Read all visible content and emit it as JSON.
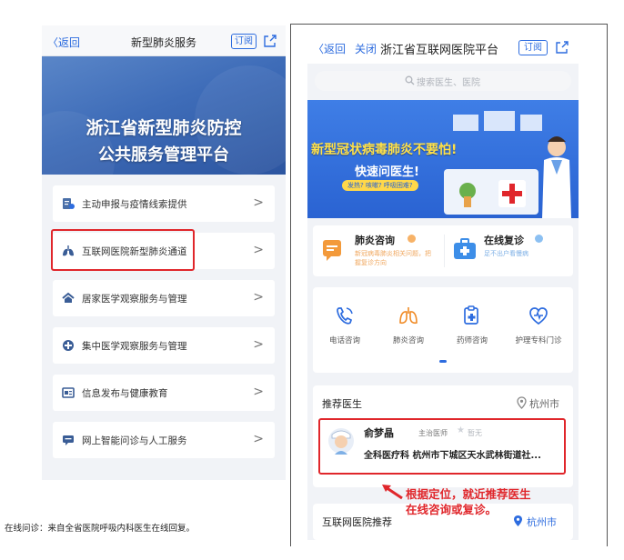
{
  "left_phone": {
    "topbar": {
      "back_label": "〈返回",
      "title": "新型肺炎服务",
      "subscribe_label": "订阅"
    },
    "banner": {
      "line1": "浙江省新型肺炎防控",
      "line2": "公共服务管理平台"
    },
    "menu": [
      {
        "label": "主动申报与疫情线索提供",
        "icon": "report-icon"
      },
      {
        "label": "互联网医院新型肺炎通道",
        "icon": "lungs-icon",
        "highlighted": true
      },
      {
        "label": "居家医学观察服务与管理",
        "icon": "home-icon"
      },
      {
        "label": "集中医学观察服务与管理",
        "icon": "cross-icon"
      },
      {
        "label": "信息发布与健康教育",
        "icon": "news-icon"
      },
      {
        "label": "网上智能问诊与人工服务",
        "icon": "chat-icon"
      }
    ],
    "chevron": ">"
  },
  "right_phone": {
    "topbar": {
      "back_label": "〈返回",
      "close_label": "关闭",
      "title": "浙江省互联网医院平台",
      "subscribe_label": "订阅"
    },
    "search": {
      "placeholder": "搜索医生、医院"
    },
    "banner": {
      "headline": "新型冠状病毒肺炎不要怕!",
      "subline": "快速问医生!",
      "pill": "发热? 咳嗽? 呼吸困难?"
    },
    "services": [
      {
        "title": "肺炎咨询",
        "sub": "新冠病毒肺炎相关问题，把握复诊方向",
        "icon": "consult-icon"
      },
      {
        "title": "在线复诊",
        "sub": "足不出户看慢病",
        "icon": "medkit-icon"
      }
    ],
    "grid": [
      {
        "label": "电话咨询",
        "icon": "phone-icon"
      },
      {
        "label": "肺炎咨询",
        "icon": "lungs-icon"
      },
      {
        "label": "药师咨询",
        "icon": "pharmacist-icon"
      },
      {
        "label": "护理专科门诊",
        "icon": "nursing-icon"
      }
    ],
    "recommend": {
      "title": "推荐医生",
      "location": "杭州市",
      "doctor": {
        "name": "俞梦晶",
        "title": "主治医师",
        "rating": "暂无",
        "line": "全科医疗科 杭州市下城区天水武林街道社..."
      }
    },
    "hospital_section": {
      "title": "互联网医院推荐",
      "location": "杭州市"
    }
  },
  "annotation": {
    "line1": "根据定位，就近推荐医生",
    "line2": "在线咨询或复诊。"
  },
  "caption": "在线问诊：来自全省医院呼吸内科医生在线回复。",
  "colors": {
    "accent_blue": "#2d6cdf",
    "highlight_red": "#e0262b",
    "banner_yellow": "#ffe14a"
  }
}
